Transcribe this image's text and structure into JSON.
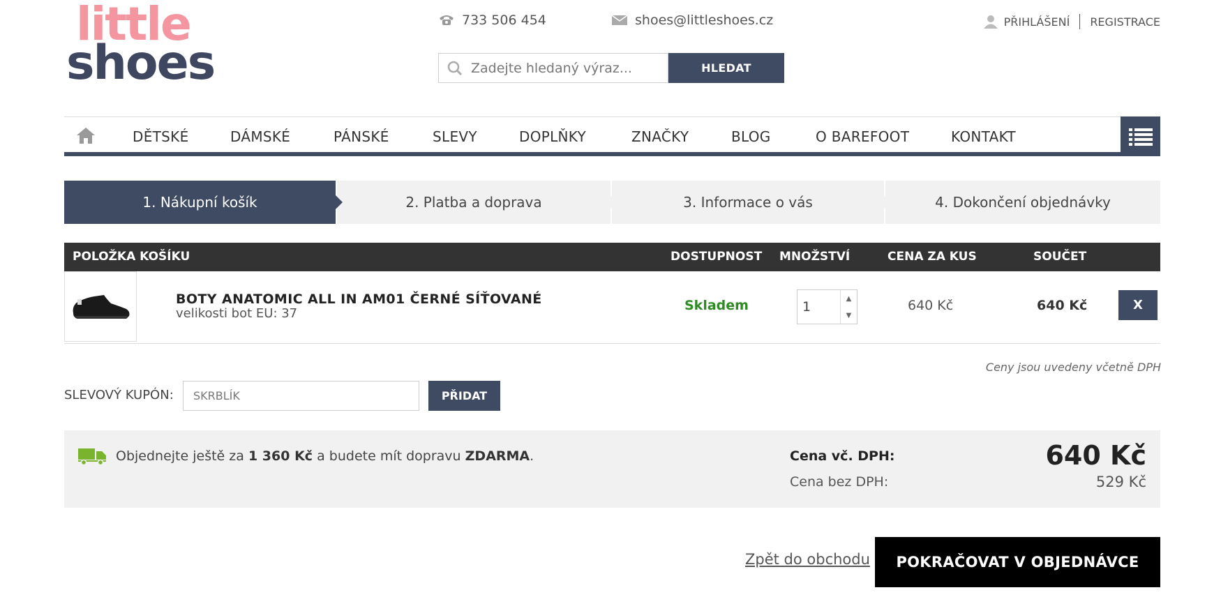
{
  "logo": {
    "line1": "little",
    "line2": "shoes"
  },
  "header": {
    "phone": "733 506 454",
    "email": "shoes@littleshoes.cz",
    "search_placeholder": "Zadejte hledaný výraz...",
    "search_button": "HLEDAT",
    "login": "PŘIHLÁŠENÍ",
    "register": "REGISTRACE"
  },
  "nav": {
    "items": [
      "DĚTSKÉ",
      "DÁMSKÉ",
      "PÁNSKÉ",
      "SLEVY",
      "DOPLŇKY",
      "ZNAČKY",
      "BLOG",
      "O BAREFOOT",
      "KONTAKT"
    ]
  },
  "steps": [
    "1. Nákupní košík",
    "2. Platba a doprava",
    "3. Informace o vás",
    "4. Dokončení objednávky"
  ],
  "table": {
    "headers": {
      "item": "POLOŽKA KOŠÍKU",
      "availability": "DOSTUPNOST",
      "quantity": "MNOŽSTVÍ",
      "unit_price": "CENA ZA KUS",
      "total": "SOUČET"
    },
    "rows": [
      {
        "name": "BOTY ANATOMIC ALL IN AM01 ČERNÉ SÍŤOVANÉ",
        "variant": "velikosti bot EU: 37",
        "availability": "Skladem",
        "quantity": "1",
        "unit_price": "640 Kč",
        "total": "640 Kč",
        "remove": "X"
      }
    ]
  },
  "vat_note": "Ceny jsou uvedeny včetně DPH",
  "coupon": {
    "label": "SLEVOVÝ KUPÓN:",
    "value": "SKRBLÍK",
    "button": "PŘIDAT"
  },
  "summary": {
    "ship_pre": "Objednejte ještě za",
    "ship_amount": "1 360 Kč",
    "ship_mid": "a budete mít dopravu",
    "ship_free": "ZDARMA",
    "ship_end": ".",
    "price_vat_label": "Cena vč. DPH:",
    "price_vat": "640 Kč",
    "price_novat_label": "Cena bez DPH:",
    "price_novat": "529 Kč"
  },
  "actions": {
    "back": "Zpět do obchodu",
    "continue": "POKRAČOVAT V OBJEDNÁVCE"
  },
  "colors": {
    "primary": "#3f4a63",
    "logo_pink": "#f4959f",
    "stock_green": "#2e8a22",
    "truck_green": "#7ab32e"
  }
}
